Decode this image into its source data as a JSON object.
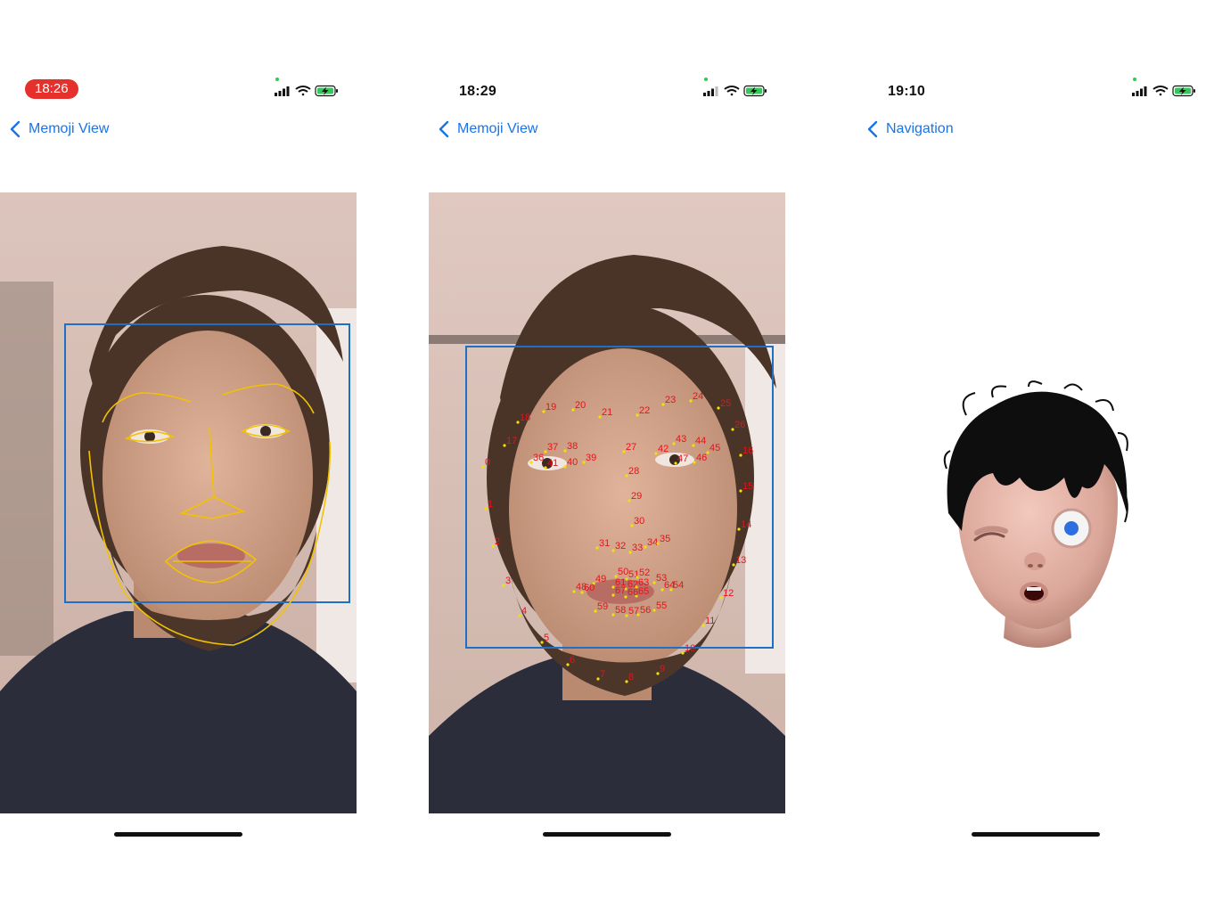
{
  "screens": [
    {
      "time": "18:26",
      "time_style": "recording-pill",
      "back_label": "Memoji View",
      "overlay": "face-contours"
    },
    {
      "time": "18:29",
      "time_style": "plain",
      "back_label": "Memoji View",
      "overlay": "numbered-landmarks",
      "landmark_labels": [
        "0",
        "1",
        "2",
        "3",
        "4",
        "5",
        "6",
        "7",
        "8",
        "9",
        "10",
        "11",
        "12",
        "13",
        "14",
        "15",
        "16",
        "17",
        "18",
        "19",
        "20",
        "21",
        "22",
        "23",
        "24",
        "25",
        "26",
        "27",
        "28",
        "29",
        "30",
        "31",
        "32",
        "33",
        "34",
        "35",
        "36",
        "37",
        "38",
        "39",
        "40",
        "41",
        "42",
        "43",
        "44",
        "45",
        "46",
        "47",
        "48",
        "49",
        "50",
        "51",
        "52",
        "53",
        "54",
        "55",
        "56",
        "57",
        "58",
        "59",
        "60",
        "61",
        "62",
        "63",
        "64",
        "65",
        "66",
        "67"
      ]
    },
    {
      "time": "19:10",
      "time_style": "plain",
      "back_label": "Navigation",
      "overlay": "memoji-avatar"
    }
  ],
  "colors": {
    "accent": "#1a73e8",
    "recording": "#e5302b",
    "face_box": "#1f6fc4",
    "contour": "#f2c200",
    "landmark_text": "#e8121b",
    "battery": "#35c759"
  },
  "icons": [
    "signal-icon",
    "wifi-icon",
    "battery-charging-icon",
    "back-chevron-icon",
    "camera-indicator-dot"
  ]
}
